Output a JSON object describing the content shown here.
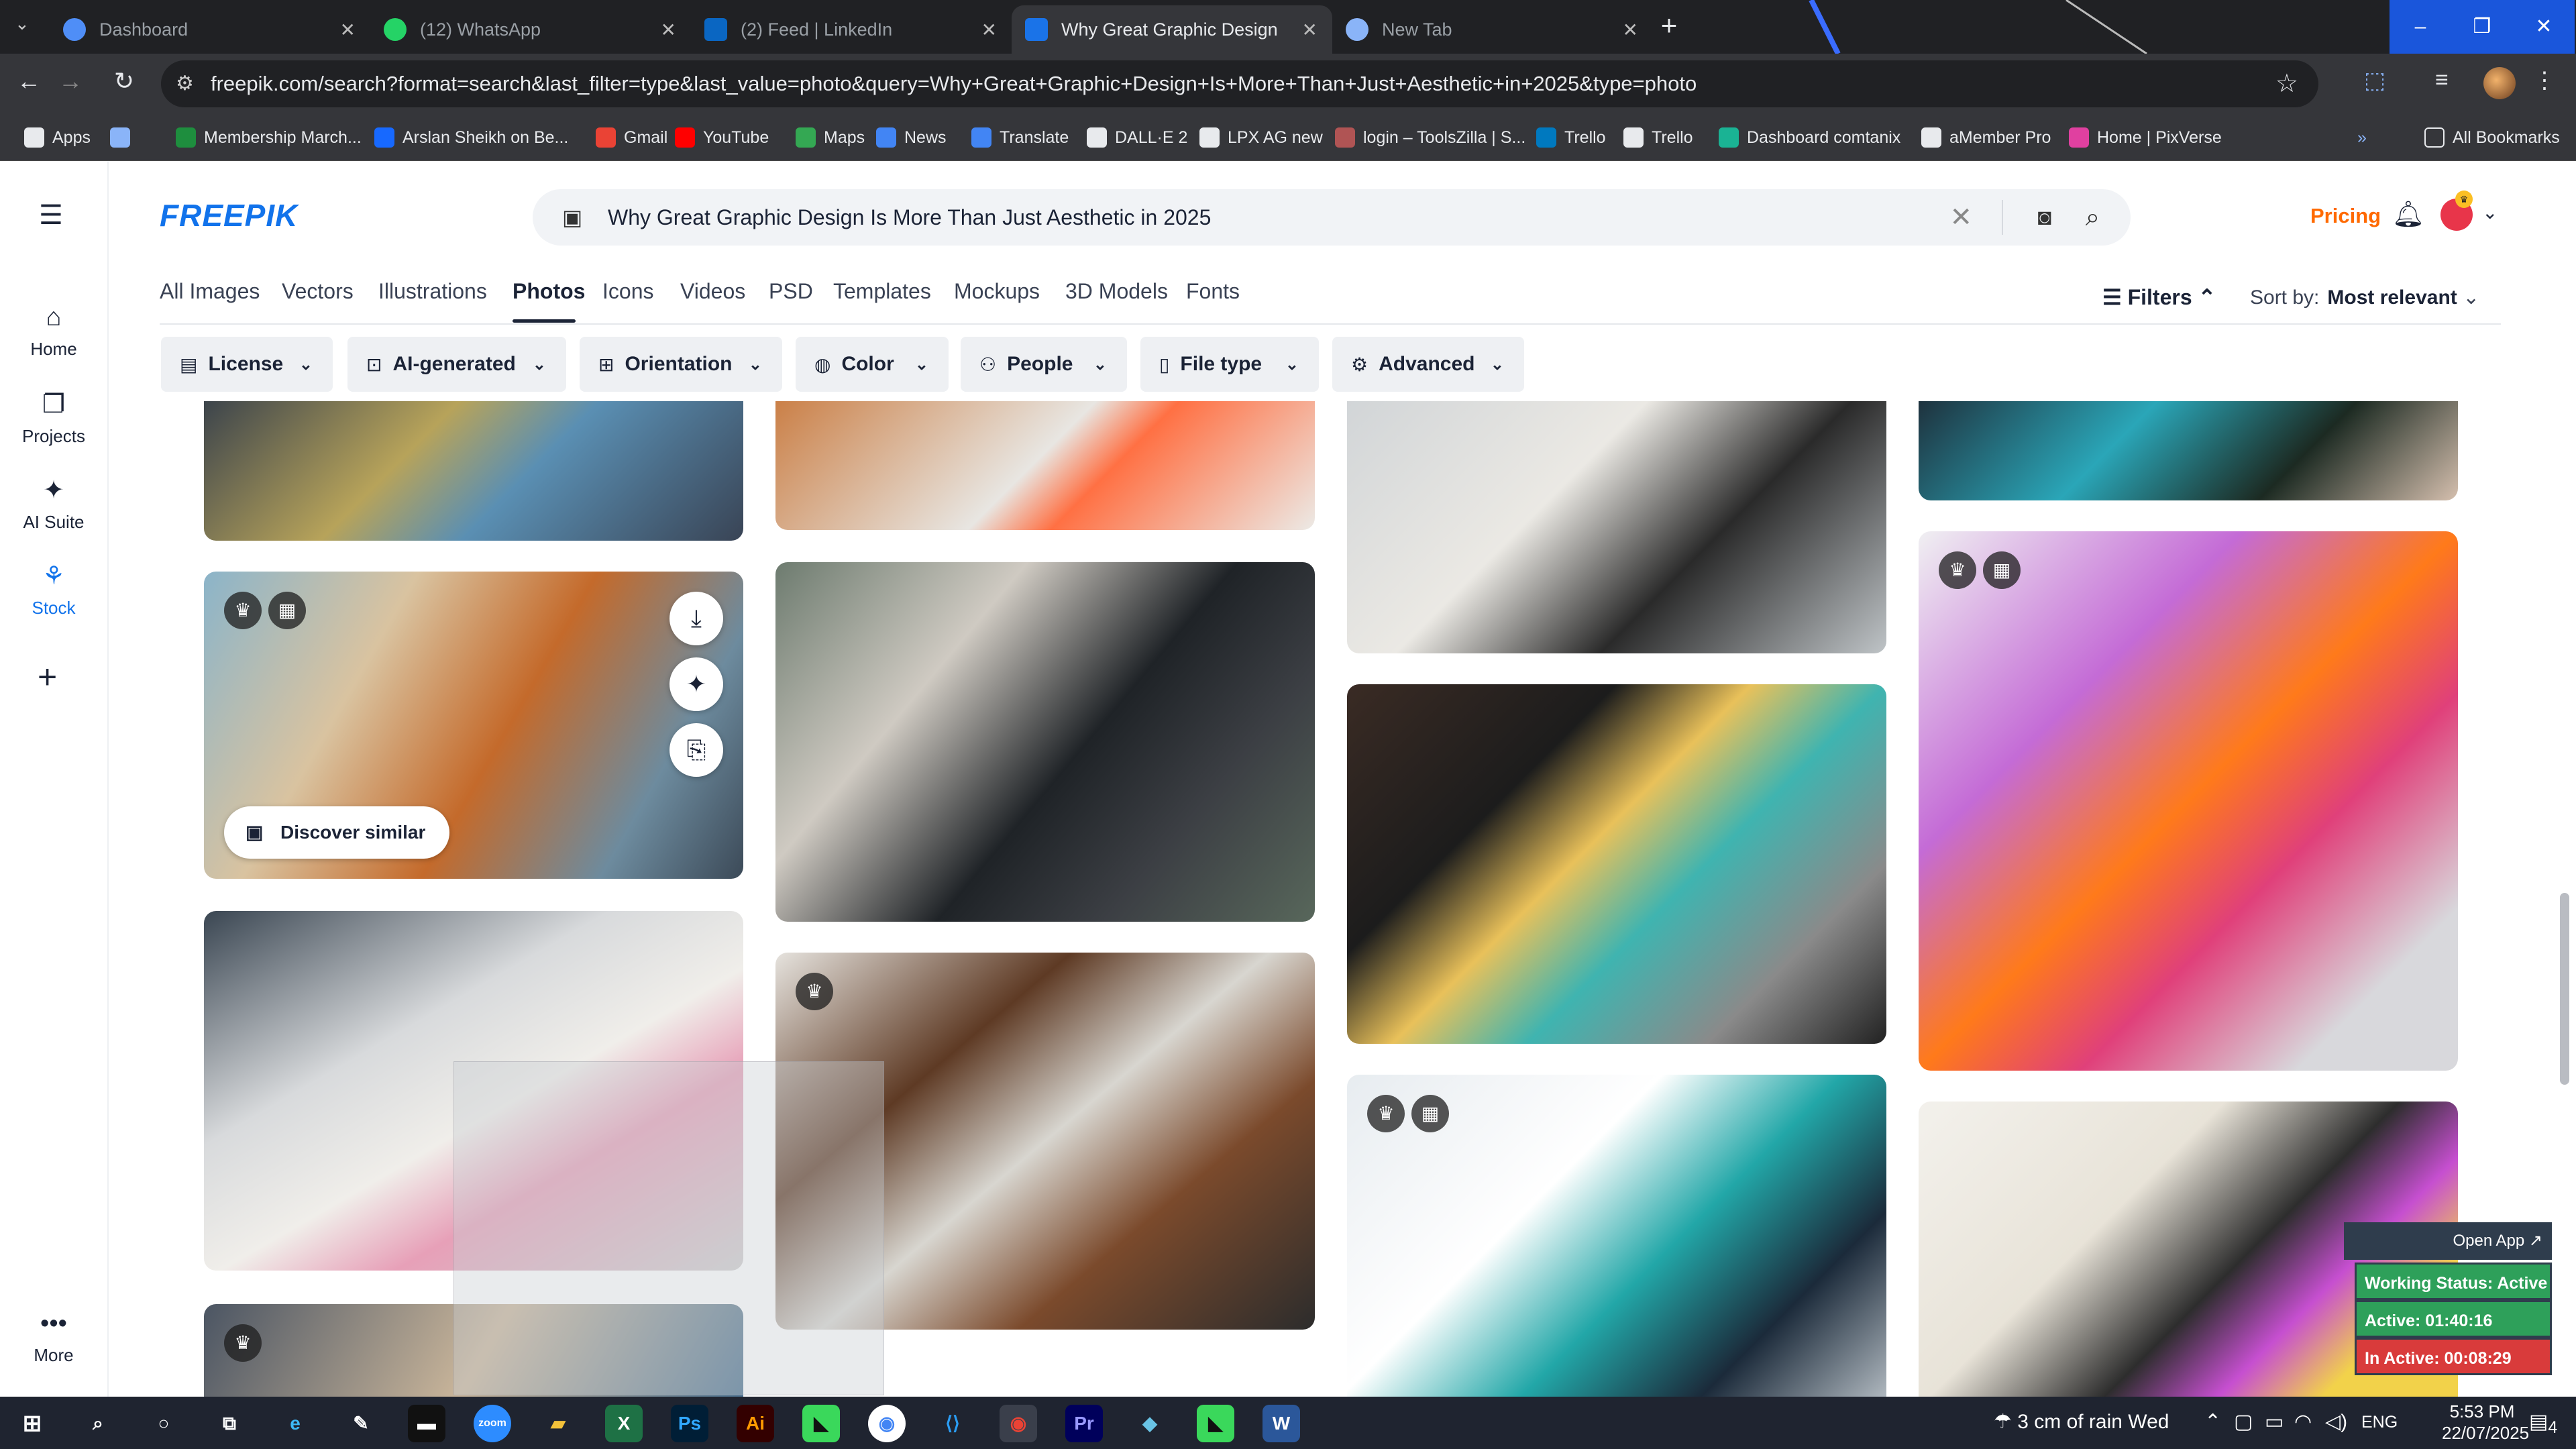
{
  "browser": {
    "tabs": [
      {
        "title": "Dashboard",
        "icon": "dashboard-icon",
        "color": "#4f8ef7"
      },
      {
        "title": "(12) WhatsApp",
        "icon": "whatsapp-icon",
        "color": "#25d366"
      },
      {
        "title": "(2) Feed | LinkedIn",
        "icon": "linkedin-icon",
        "color": "#0a66c2"
      },
      {
        "title": "Why Great Graphic Design Is M",
        "icon": "freepik-icon",
        "color": "#1a73e8"
      },
      {
        "title": "New Tab",
        "icon": "chrome-icon",
        "color": "#8ab4f8"
      }
    ],
    "url": "freepik.com/search?format=search&last_filter=type&last_value=photo&query=Why+Great+Graphic+Design+Is+More+Than+Just+Aesthetic+in+2025&type=photo",
    "bookmarks": [
      {
        "label": "Apps",
        "color": "#e8eaed"
      },
      {
        "label": "",
        "color": "#8ab4f8"
      },
      {
        "label": "Membership March...",
        "color": "#1e8e3e"
      },
      {
        "label": "Arslan Sheikh on Be...",
        "color": "#1769ff"
      },
      {
        "label": "Gmail",
        "color": "#ea4335"
      },
      {
        "label": "YouTube",
        "color": "#ff0000"
      },
      {
        "label": "Maps",
        "color": "#34a853"
      },
      {
        "label": "News",
        "color": "#4285f4"
      },
      {
        "label": "Translate",
        "color": "#4285f4"
      },
      {
        "label": "DALL·E 2",
        "color": "#e8eaed"
      },
      {
        "label": "LPX AG new",
        "color": "#e8eaed"
      },
      {
        "label": "login – ToolsZilla | S...",
        "color": "#b05454"
      },
      {
        "label": "Trello",
        "color": "#0079bf"
      },
      {
        "label": "Trello",
        "color": "#e8eaed"
      },
      {
        "label": "Dashboard comtanix",
        "color": "#1ab394"
      },
      {
        "label": "aMember Pro",
        "color": "#e8eaed"
      },
      {
        "label": "Home | PixVerse",
        "color": "#e040a0"
      }
    ],
    "all_bookmarks": "All Bookmarks"
  },
  "header": {
    "brand": "FREEPIK",
    "search_query": "Why Great Graphic Design Is More Than Just Aesthetic in 2025",
    "pricing": "Pricing"
  },
  "leftnav": {
    "items": [
      {
        "label": "Home",
        "icon": "home-icon"
      },
      {
        "label": "Projects",
        "icon": "projects-icon"
      },
      {
        "label": "AI Suite",
        "icon": "ai-suite-icon"
      },
      {
        "label": "Stock",
        "icon": "stock-icon"
      }
    ],
    "more": "More"
  },
  "type_tabs": [
    "All Images",
    "Vectors",
    "Illustrations",
    "Photos",
    "Icons",
    "Videos",
    "PSD",
    "Templates",
    "Mockups",
    "3D Models",
    "Fonts"
  ],
  "selected_tab": "Photos",
  "filters_label": "Filters",
  "sort": {
    "label": "Sort by:",
    "value": "Most relevant"
  },
  "filter_chips": [
    {
      "label": "License",
      "icon": "license-icon"
    },
    {
      "label": "AI-generated",
      "icon": "ai-icon"
    },
    {
      "label": "Orientation",
      "icon": "orientation-icon"
    },
    {
      "label": "Color",
      "icon": "palette-icon"
    },
    {
      "label": "People",
      "icon": "people-icon"
    },
    {
      "label": "File type",
      "icon": "file-icon"
    },
    {
      "label": "Advanced",
      "icon": "settings-icon"
    }
  ],
  "discover_similar": "Discover similar",
  "widget": {
    "open_app": "Open App ↗",
    "working_status": "Working Status: Active",
    "active": "Active: 01:40:16",
    "inactive": "In Active: 00:08:29",
    "colors": {
      "working": "#2ea05a",
      "active": "#2ea05a",
      "inactive": "#d93b3b"
    }
  },
  "taskbar": {
    "weather": "3 cm of rain  Wed",
    "lang": "ENG",
    "time": "5:53 PM",
    "date": "22/07/2025",
    "notifications": "4"
  }
}
